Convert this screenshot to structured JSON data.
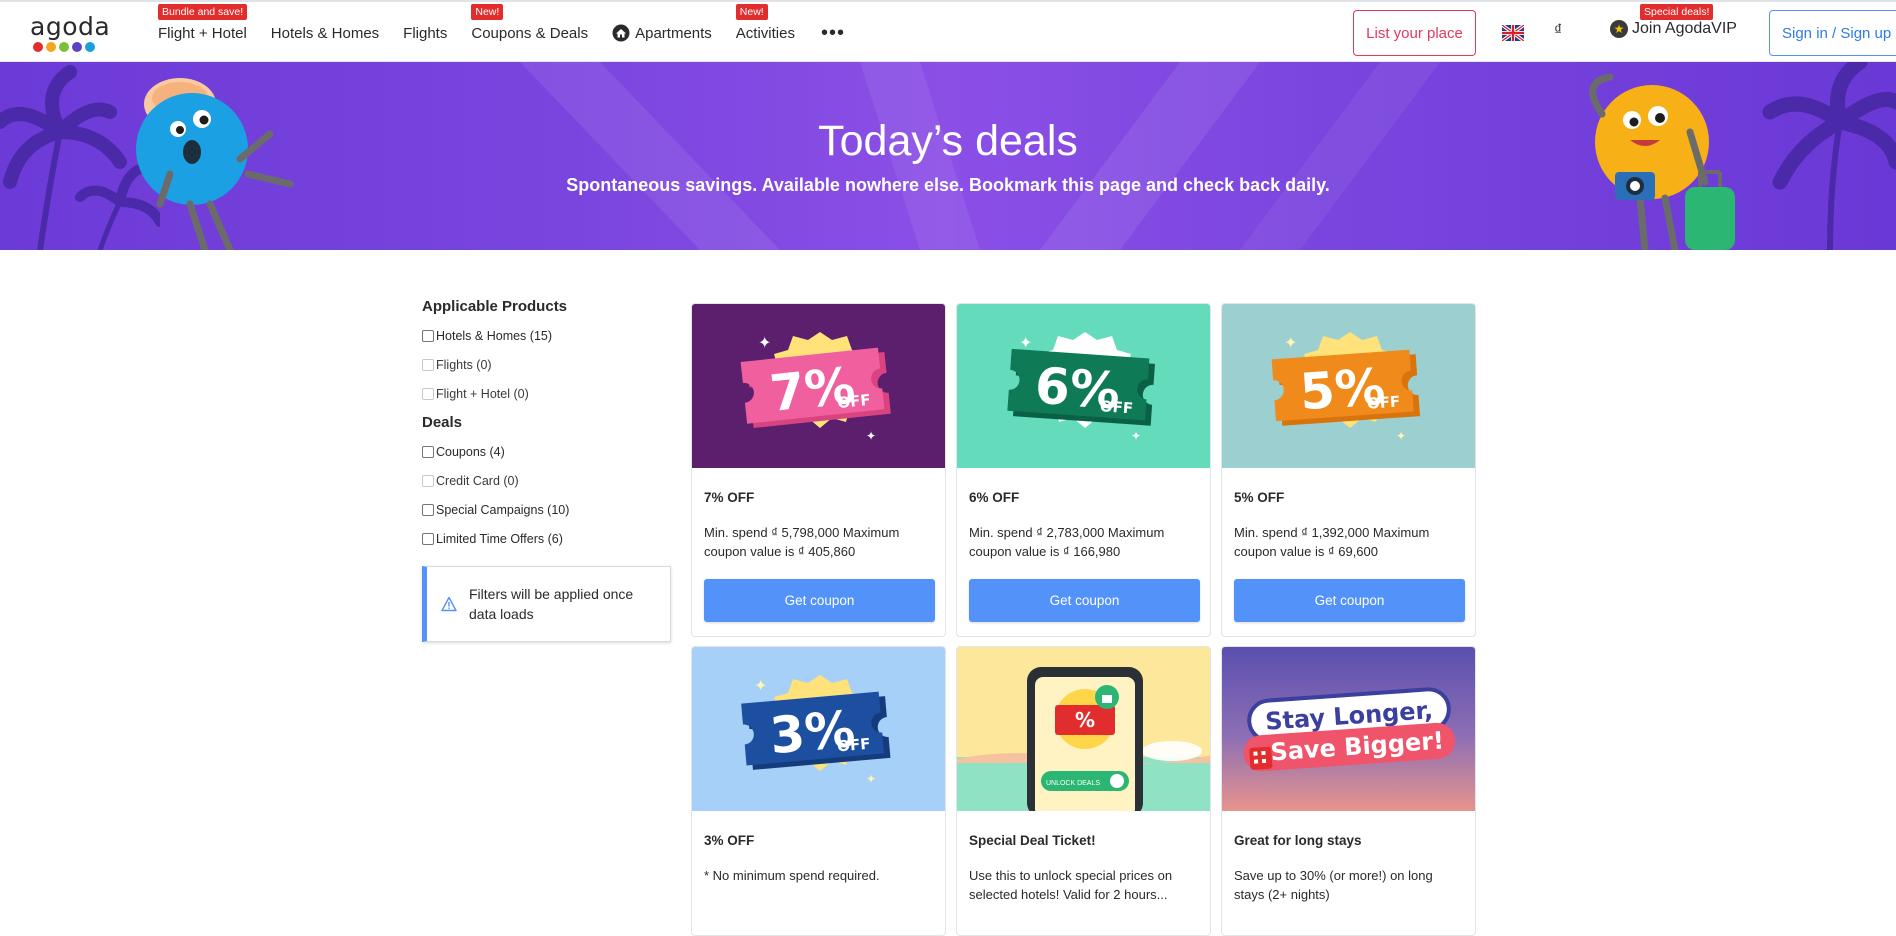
{
  "header": {
    "logo_text": "agoda",
    "logo_dot_colors": [
      "#e12d2d",
      "#f4a621",
      "#7dc03a",
      "#5b43c8",
      "#1aa0d6"
    ],
    "nav": [
      {
        "label": "Flight + Hotel",
        "badge": "Bundle and save!"
      },
      {
        "label": "Hotels & Homes",
        "badge": null
      },
      {
        "label": "Flights",
        "badge": null
      },
      {
        "label": "Coupons & Deals",
        "badge": "New!"
      },
      {
        "label": "Apartments",
        "badge": null,
        "icon": "home-icon"
      },
      {
        "label": "Activities",
        "badge": "New!"
      }
    ],
    "more_label": "•••",
    "list_place": "List your place",
    "currency": "₫",
    "vip_label": "Join AgodaVIP",
    "vip_badge": "Special deals!",
    "signin": "Sign in / Sign up"
  },
  "banner": {
    "title": "Today’s deals",
    "subtitle": "Spontaneous savings. Available nowhere else. Bookmark this page and check back daily."
  },
  "sidebar": {
    "products_title": "Applicable Products",
    "products": [
      {
        "label": "Hotels & Homes (15)",
        "disabled": false
      },
      {
        "label": "Flights (0)",
        "disabled": true
      },
      {
        "label": "Flight + Hotel (0)",
        "disabled": true
      }
    ],
    "deals_title": "Deals",
    "deals": [
      {
        "label": "Coupons (4)",
        "disabled": false
      },
      {
        "label": "Credit Card (0)",
        "disabled": true
      },
      {
        "label": "Special Campaigns (10)",
        "disabled": false
      },
      {
        "label": "Limited Time Offers (6)",
        "disabled": false
      }
    ],
    "notice": "Filters will be applied once data loads"
  },
  "cards": [
    {
      "title": "7% OFF",
      "desc": "Min. spend ₫ 5,798,000 Maximum coupon value is ₫ 405,860",
      "button": "Get coupon",
      "bg": "#5c1f6e",
      "ticket_color": "#f0609f",
      "ticket_dark": "#d9437f",
      "pct": "7%",
      "off": "OFF"
    },
    {
      "title": "6% OFF",
      "desc": "Min. spend ₫ 2,783,000 Maximum coupon value is ₫ 166,980",
      "button": "Get coupon",
      "bg": "#64dbba",
      "ticket_color": "#0e7a56",
      "ticket_dark": "#0a6045",
      "pct": "6%",
      "off": "OFF"
    },
    {
      "title": "5% OFF",
      "desc": "Min. spend ₫ 1,392,000 Maximum coupon value is ₫ 69,600",
      "button": "Get coupon",
      "bg": "#9ccfcf",
      "ticket_color": "#f08a1a",
      "ticket_dark": "#d9730c",
      "pct": "5%",
      "off": "OFF"
    },
    {
      "title": "3% OFF",
      "desc": "* No minimum spend required.",
      "button": null,
      "bg": "#a6d0f7",
      "ticket_color": "#1c4fa0",
      "ticket_dark": "#143b7c",
      "pct": "3%",
      "off": "OFF"
    },
    {
      "title": "Special Deal Ticket!",
      "desc": "Use this to unlock special prices on selected hotels! Valid for 2 hours...",
      "button": null,
      "bg": "#fde79a",
      "unlock_label": "UNLOCK DEALS",
      "pct_symbol": "%"
    },
    {
      "title": "Great for long stays",
      "desc": "Save up to 30% (or more!) on long stays (2+ nights)",
      "button": null,
      "bg": "#6a5aa8",
      "line1": "Stay Longer,",
      "line2": "Save Bigger!"
    }
  ]
}
